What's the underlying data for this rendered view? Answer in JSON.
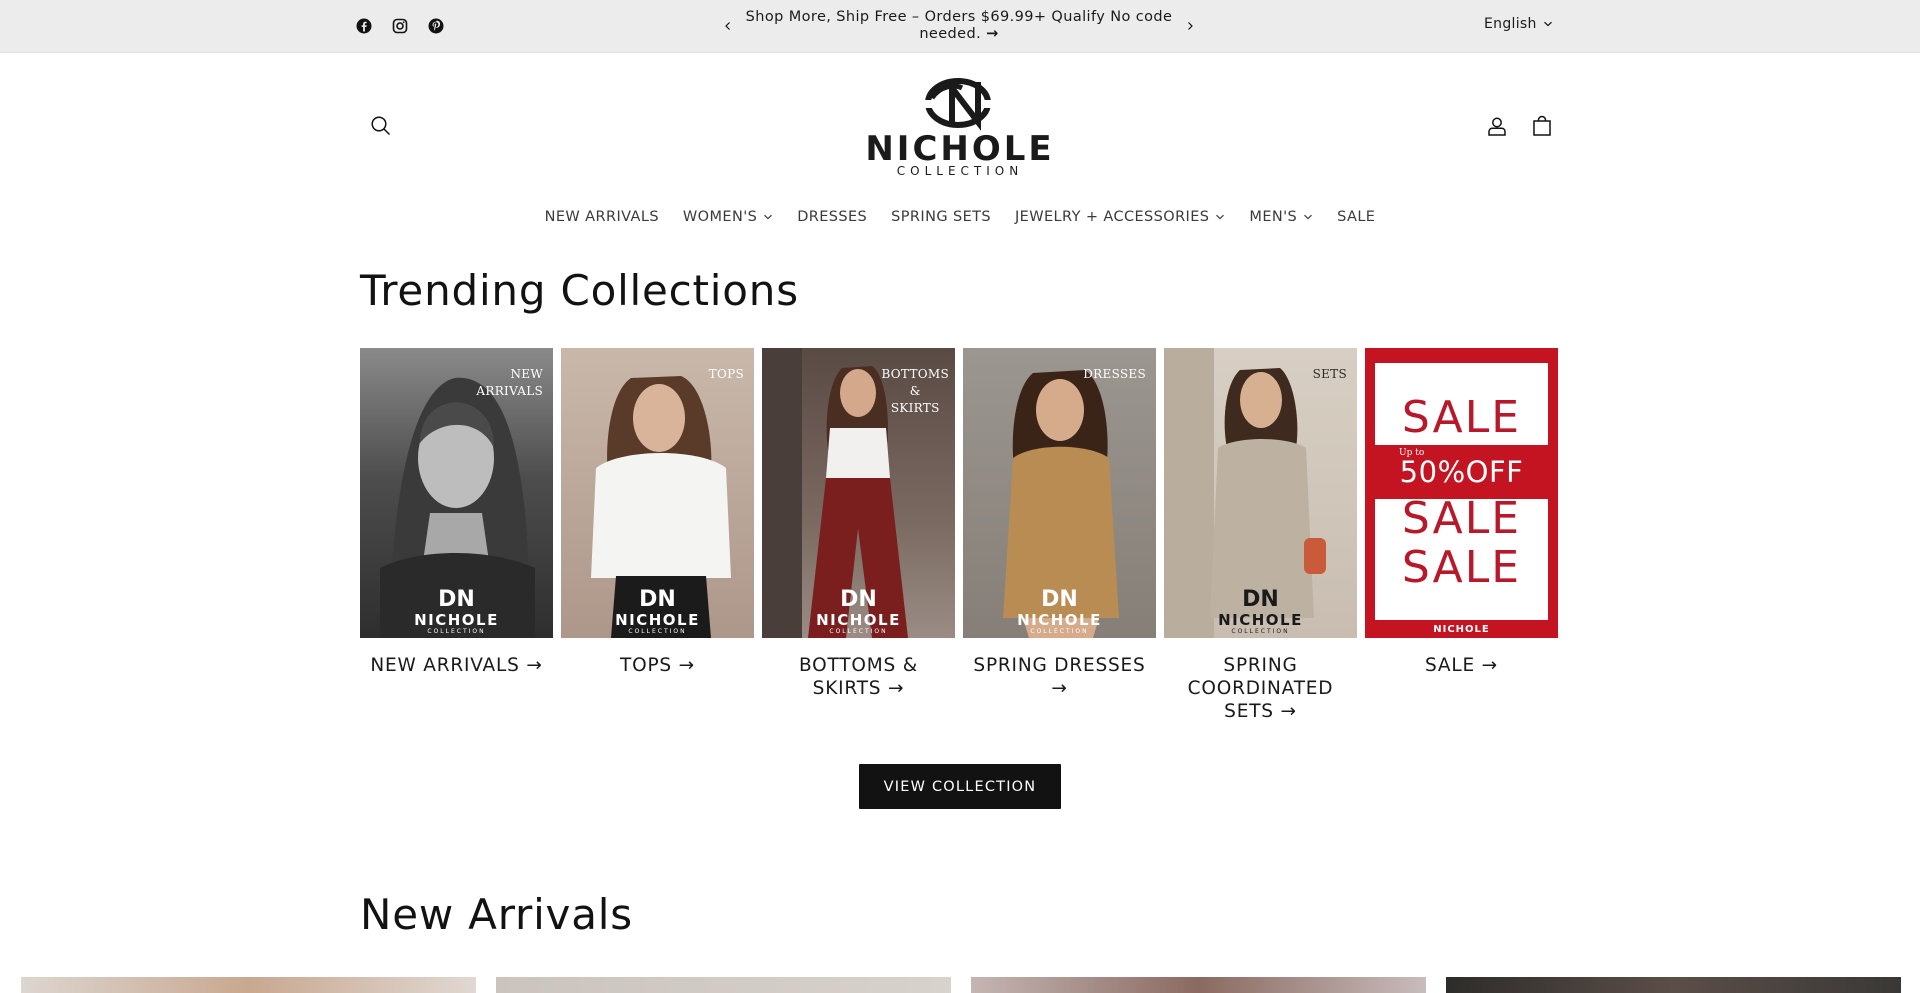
{
  "announcement": {
    "social": [
      "facebook-icon",
      "instagram-icon",
      "pinterest-icon"
    ],
    "text": "Shop More, Ship Free – Orders $69.99+ Qualify   No code needed.",
    "arrow": "→",
    "prev_icon": "chevron-left-icon",
    "next_icon": "chevron-right-icon"
  },
  "language": {
    "selected": "English"
  },
  "header": {
    "brand_mark": "DN",
    "brand_name": "NICHOLE",
    "brand_sub": "COLLECTION",
    "icons": [
      "search-icon",
      "account-icon",
      "cart-icon"
    ]
  },
  "nav": [
    {
      "label": "NEW ARRIVALS",
      "dropdown": false
    },
    {
      "label": "WOMEN'S",
      "dropdown": true
    },
    {
      "label": "DRESSES",
      "dropdown": false
    },
    {
      "label": "SPRING SETS",
      "dropdown": false
    },
    {
      "label": "JEWELRY + ACCESSORIES",
      "dropdown": true
    },
    {
      "label": "MEN'S",
      "dropdown": true
    },
    {
      "label": "SALE",
      "dropdown": false
    }
  ],
  "trending": {
    "title": "Trending Collections",
    "cards": [
      {
        "label": "NEW ARRIVALS →",
        "tag": "NEW\nARRIVALS",
        "bg": "#5a5a5a"
      },
      {
        "label": "TOPS →",
        "tag": "TOPS",
        "bg": "#9a8070"
      },
      {
        "label": "BOTTOMS & SKIRTS →",
        "tag": "BOTTOMS\n&\nSKIRTS",
        "bg": "#6b3a34"
      },
      {
        "label": "SPRING DRESSES →",
        "tag": "DRESSES",
        "bg": "#a88452"
      },
      {
        "label": "SPRING COORDINATED SETS →",
        "tag": "SETS",
        "bg": "#bcb2a4"
      },
      {
        "label": "SALE →",
        "tag": "",
        "bg": "#c41422"
      }
    ],
    "sale_graphic": {
      "word": "SALE",
      "upto": "Up to",
      "percent": "50%OFF",
      "brand": "NICHOLE"
    },
    "button": "VIEW COLLECTION"
  },
  "new_arrivals": {
    "title": "New Arrivals",
    "thumb_colors": [
      "#d8c4b8",
      "#cfc6c0",
      "#b9a8a6",
      "#3c3a38"
    ]
  },
  "colors": {
    "announcement_bg": "#ececec",
    "button_bg": "#121212",
    "sale_red": "#c41422"
  }
}
